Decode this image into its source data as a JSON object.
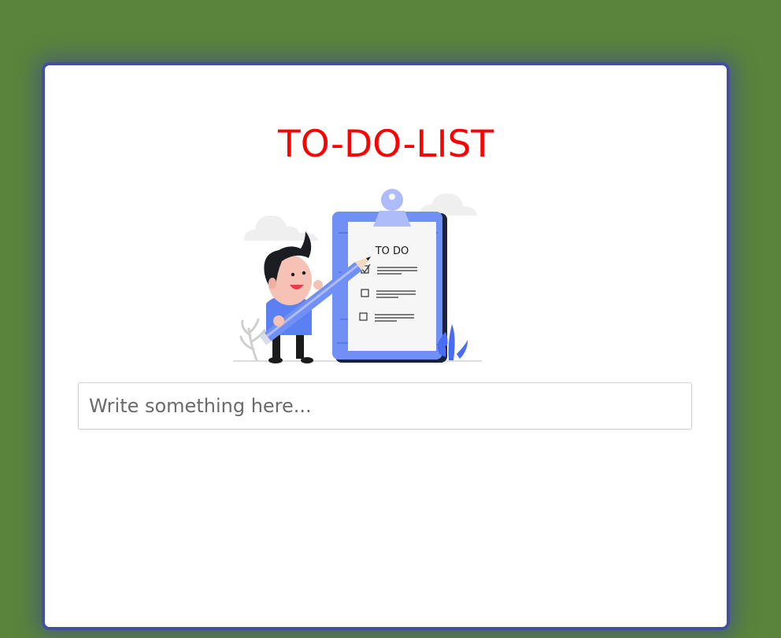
{
  "app": {
    "title": "TO-DO-LIST"
  },
  "illustration": {
    "clipboard_heading": "TO DO",
    "checklist_items": [
      {
        "checked": true
      },
      {
        "checked": false
      },
      {
        "checked": false
      }
    ]
  },
  "input": {
    "value": "",
    "placeholder": "Write something here..."
  },
  "tasks": [],
  "colors": {
    "background": "#5a843b",
    "card": "#ffffff",
    "card_border": "#44509d",
    "title": "#ff0000",
    "clipboard": "#6d8cf0",
    "character_shirt": "#5b80f2"
  }
}
